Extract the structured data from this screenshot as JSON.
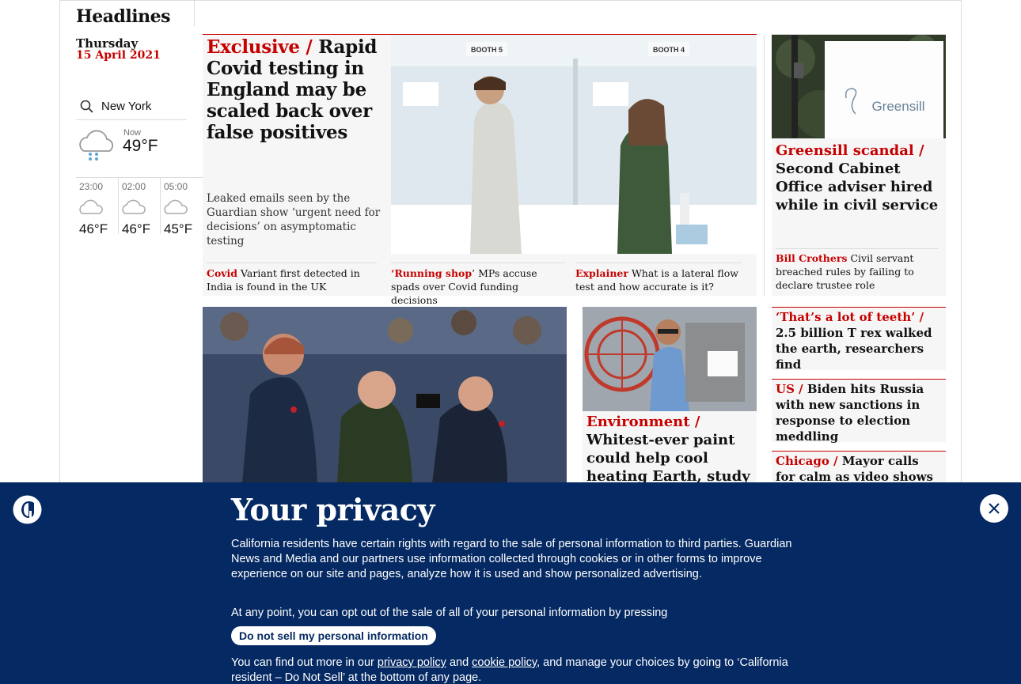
{
  "sidebar": {
    "section_title": "Headlines",
    "day": "Thursday",
    "date": "15 April 2021",
    "weather": {
      "location": "New York",
      "now_label": "Now",
      "now_temp": "49°F",
      "forecast": [
        {
          "time": "23:00",
          "temp": "46°F",
          "icon": "cloud-icon"
        },
        {
          "time": "02:00",
          "temp": "46°F",
          "icon": "cloud-icon"
        },
        {
          "time": "05:00",
          "temp": "45°F",
          "icon": "cloud-icon"
        }
      ]
    }
  },
  "lead": {
    "kicker": "Exclusive /",
    "headline": "Rapid Covid testing in England may be scaled back over false positives",
    "standfirst": "Leaked emails seen by the Guardian show ‘urgent need for decisions’ on asymptomatic testing",
    "photo_booth_a": "BOOTH 5",
    "photo_booth_b": "BOOTH 4",
    "subs": [
      {
        "kicker": "Covid",
        "text": "Variant first detected in India is found in the UK"
      },
      {
        "kicker": "‘Running shop",
        "text": "’ MPs accuse spads over Covid funding decisions"
      },
      {
        "kicker": "Explainer",
        "text": "What is a lateral flow test and how accurate is it?"
      }
    ]
  },
  "greensill": {
    "photo_sign": "Greensill",
    "kicker": "Greensill scandal /",
    "headline": "Second Cabinet Office adviser hired while in civil service",
    "sub_kicker": "Bill Crothers",
    "sub_text": "Civil servant breached rules by failing to declare trustee role"
  },
  "paint": {
    "kicker": "Environment /",
    "headline": "Whitest-ever paint could help cool heating Earth, study"
  },
  "small_stories": [
    {
      "kicker": "‘That’s a lot of teeth’ /",
      "headline": "2.5 billion T rex walked the earth, researchers find"
    },
    {
      "kicker": "US /",
      "headline": "Biden hits Russia with new sanctions in response to election meddling"
    },
    {
      "kicker": "Chicago /",
      "headline": "Mayor calls for calm as video shows police"
    }
  ],
  "privacy": {
    "title": "Your privacy",
    "body": "California residents have certain rights with regard to the sale of personal information to third parties. Guardian News and Media and our partners use information collected through cookies or in other forms to improve experience on our site and pages, analyze how it is used and show personalized advertising.",
    "body2": "At any point, you can opt out of the sale of all of your personal information by pressing",
    "button": "Do not sell my personal information",
    "body3_prefix": "You can find out more in our",
    "privacy_link": "privacy policy",
    "and": "and",
    "cookie_link": "cookie policy",
    "body3_suffix": ", and manage your choices by going to ‘California resident – Do Not Sell’ at the bottom of any page."
  },
  "colors": {
    "accent": "#c70000",
    "privacy_bg": "#052962"
  }
}
